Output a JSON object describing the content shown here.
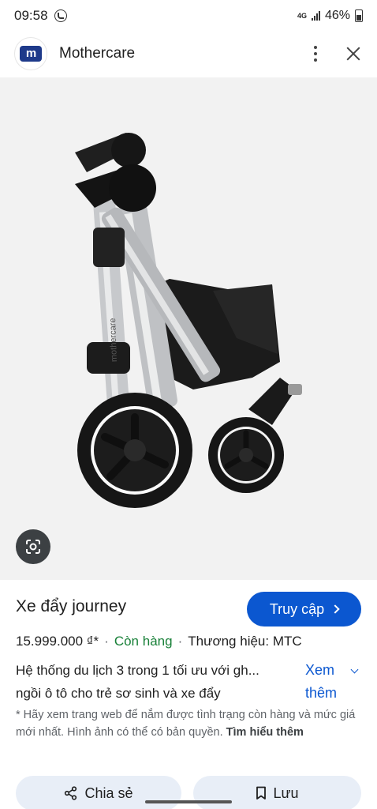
{
  "status": {
    "time": "09:58",
    "network": "4G",
    "battery": "46%"
  },
  "header": {
    "site": "Mothercare",
    "logo_text": "m"
  },
  "product": {
    "title": "Xe đẩy journey",
    "visit_label": "Truy cập",
    "price": "15.999.000 ₫*",
    "stock": "Còn hàng",
    "brand": "Thương hiệu: MTC",
    "desc_line1": "Hệ thống du lịch 3 trong 1 tối ưu với gh...",
    "desc_line2": "ngồi ô tô cho trẻ sơ sinh và xe đẩy",
    "more_line1": "Xem",
    "more_line2": "thêm",
    "disclaimer": "* Hãy xem trang web để nắm được tình trạng còn hàng và mức giá mới nhất. Hình ảnh có thể có bản quyền.",
    "learn_more": "Tìm hiểu thêm"
  },
  "image": {
    "brand_print": "mothercare"
  },
  "actions": {
    "share": "Chia sẻ",
    "save": "Lưu"
  },
  "colors": {
    "accent": "#0b57d0",
    "stock": "#188038",
    "button_bg": "#e8eef7"
  },
  "icons": [
    "call-icon",
    "signal-icon",
    "battery-icon",
    "more-vert-icon",
    "close-icon",
    "lens-icon",
    "chevron-right-icon",
    "chevron-down-icon",
    "share-icon",
    "bookmark-icon"
  ]
}
